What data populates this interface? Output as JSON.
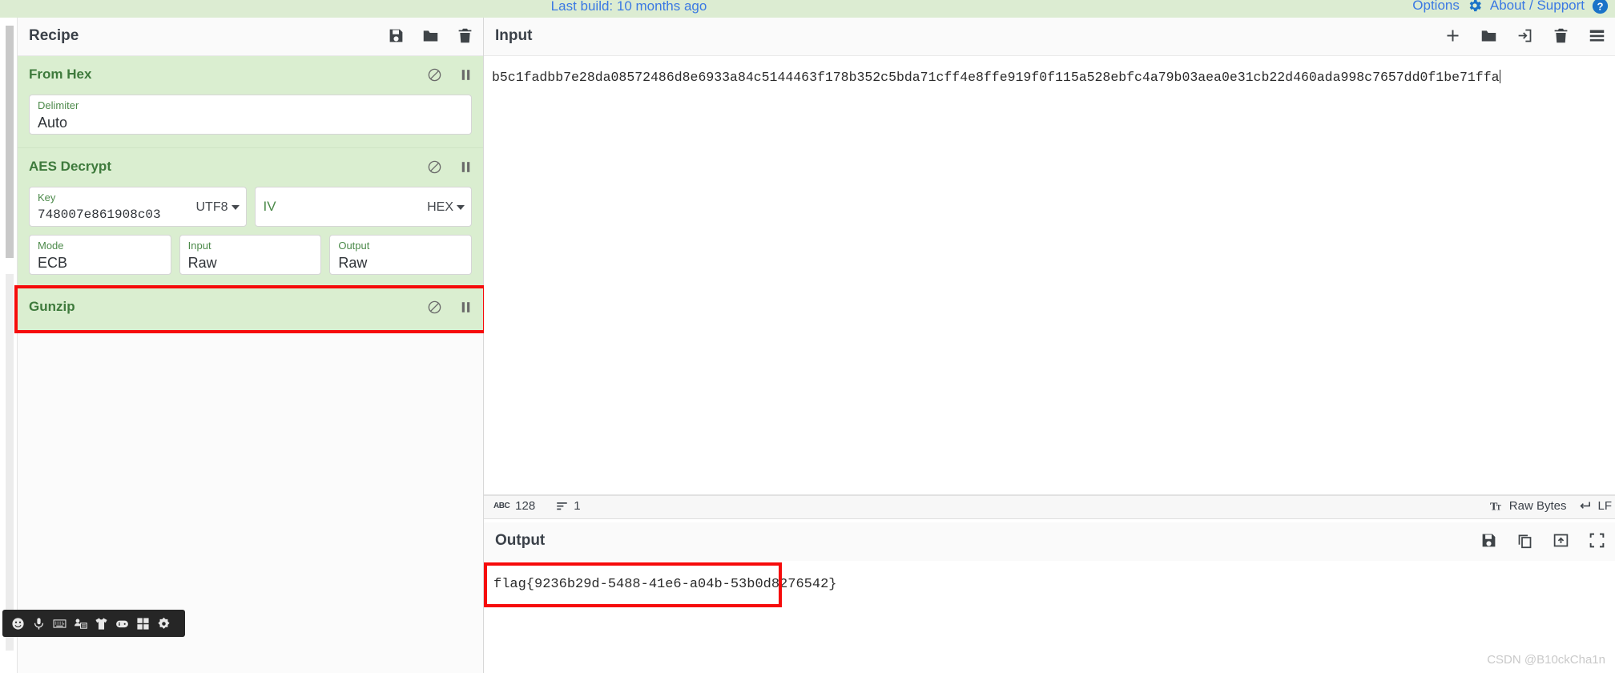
{
  "banner": {
    "build_text": "Last build: 10 months ago",
    "options_label": "Options",
    "about_label": "About / Support",
    "gear_icon": "gear-icon",
    "help_icon": "help-circle-icon",
    "link_color": "#3b79e3",
    "bg_color": "#dcecd2"
  },
  "recipe": {
    "title": "Recipe",
    "toolbar": [
      {
        "name": "save-recipe-icon",
        "label": "Save"
      },
      {
        "name": "load-recipe-icon",
        "label": "Load"
      },
      {
        "name": "clear-recipe-icon",
        "label": "Clear"
      }
    ],
    "operations": [
      {
        "name": "From Hex",
        "highlighted": false,
        "disable_icon": "disable-icon",
        "breakpoint_icon": "pause-icon",
        "args": [
          {
            "label": "Delimiter",
            "value": "Auto",
            "type": "select"
          }
        ]
      },
      {
        "name": "AES Decrypt",
        "highlighted": false,
        "disable_icon": "disable-icon",
        "breakpoint_icon": "pause-icon",
        "args": [
          {
            "label": "Key",
            "value": "748007e861908c03",
            "type": "text-with-encoding",
            "encoding": "UTF8"
          },
          {
            "label": "IV",
            "value": "",
            "type": "text-with-encoding",
            "encoding": "HEX"
          },
          {
            "label": "Mode",
            "value": "ECB",
            "type": "select"
          },
          {
            "label": "Input",
            "value": "Raw",
            "type": "select"
          },
          {
            "label": "Output",
            "value": "Raw",
            "type": "select"
          }
        ]
      },
      {
        "name": "Gunzip",
        "highlighted": true,
        "disable_icon": "disable-icon",
        "breakpoint_icon": "pause-icon",
        "args": []
      }
    ]
  },
  "input": {
    "title": "Input",
    "toolbar": [
      {
        "name": "add-tab-icon",
        "label": "Add a new input tab"
      },
      {
        "name": "open-folder-icon",
        "label": "Open folder as input"
      },
      {
        "name": "open-file-icon",
        "label": "Open file as input"
      },
      {
        "name": "clear-input-icon",
        "label": "Clear input and output"
      },
      {
        "name": "reset-pane-layout-icon",
        "label": "Reset pane layout"
      }
    ],
    "value": "b5c1fadbb7e28da08572486d8e6933a84c5144463f178b352c5bda71cff4e8ffe919f0f115a528ebfc4a79b03aea0e31cb22d460ada998c7657dd0f1be71ffa",
    "status": {
      "length_icon": "abc-icon",
      "length": "128",
      "lines_icon": "lines-icon",
      "lines": "1",
      "charenc_icon": "font-size-icon",
      "charenc_label": "Raw Bytes",
      "lineend_icon": "return-arrow-icon",
      "lineend_label": "LF"
    }
  },
  "output": {
    "title": "Output",
    "toolbar": [
      {
        "name": "save-output-icon",
        "label": "Save output to file"
      },
      {
        "name": "copy-output-icon",
        "label": "Copy raw output to the clipboard"
      },
      {
        "name": "replace-input-icon",
        "label": "Replace input with output"
      },
      {
        "name": "maximise-output-icon",
        "label": "Maximise output pane"
      }
    ],
    "value": "flag{9236b29d-5488-41e6-a04b-53b0d8276542}",
    "highlight_color": "#f60b0b"
  },
  "watermark": "CSDN @B10ckCha1n",
  "taskbar": {
    "items": [
      {
        "name": "smiley-icon",
        "label": "Emoji"
      },
      {
        "name": "microphone-icon",
        "label": "Voice input"
      },
      {
        "name": "keyboard-icon",
        "label": "Keyboard"
      },
      {
        "name": "contact-card-icon",
        "label": "Contacts"
      },
      {
        "name": "tshirt-icon",
        "label": "Stickers"
      },
      {
        "name": "gamepad-icon",
        "label": "Games"
      },
      {
        "name": "apps-grid-icon",
        "label": "Apps"
      },
      {
        "name": "settings-icon",
        "label": "Settings"
      }
    ]
  }
}
